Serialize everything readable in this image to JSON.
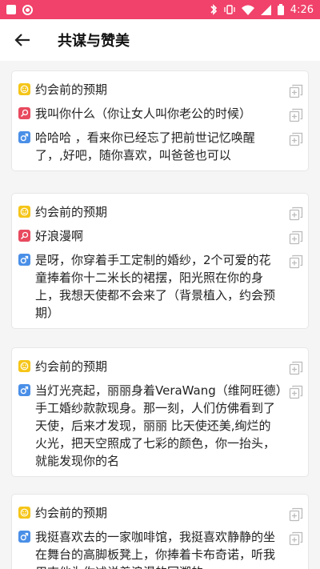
{
  "status_bar": {
    "time": "4:26"
  },
  "header": {
    "title": "共谋与赞美"
  },
  "cards": [
    {
      "rows": [
        {
          "kind": "scene",
          "text": "约会前的预期"
        },
        {
          "kind": "female",
          "text": "我叫你什么（你让女人叫你老公的时候）"
        },
        {
          "kind": "male",
          "text": "哈哈哈 ，看来你已经忘了把前世记忆唤醒了，,好吧，随你喜欢，叫爸爸也可以"
        }
      ]
    },
    {
      "rows": [
        {
          "kind": "scene",
          "text": "约会前的预期"
        },
        {
          "kind": "female",
          "text": "好浪漫啊"
        },
        {
          "kind": "male",
          "text": "是呀，你穿着手工定制的婚纱，2个可爱的花童捧着你十二米长的裙摆，阳光照在你的身上，我想天使都不会来了（背景植入，约会预期）"
        }
      ]
    },
    {
      "rows": [
        {
          "kind": "scene",
          "text": "约会前的预期"
        },
        {
          "kind": "male",
          "text": "当灯光亮起，丽丽身着VeraWang（维阿旺德）手工婚纱款款现身。那一刻，人们仿佛看到了天使，后来才发现，丽丽 比天使还美,绚烂的火光，把天空照成了七彩的颜色，你一抬头，就能发现你的名"
        }
      ]
    },
    {
      "rows": [
        {
          "kind": "scene",
          "text": "约会前的预期"
        },
        {
          "kind": "male",
          "text": "我挺喜欢去的一家咖啡馆，我挺喜欢静静的坐在舞台的高脚板凳上，你捧着卡布奇诺，听我用吉他为你述说着浪漫的回溯的"
        }
      ]
    }
  ]
}
